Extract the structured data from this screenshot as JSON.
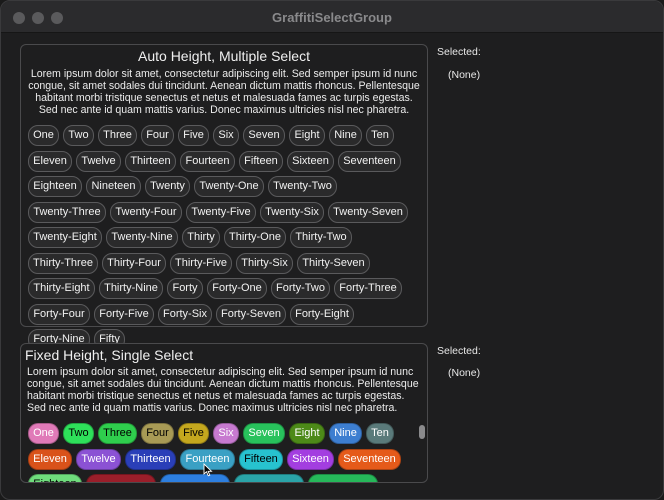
{
  "window": {
    "title": "GraffitiSelectGroup"
  },
  "description": "Lorem ipsum dolor sit amet, consectetur adipiscing elit. Sed semper ipsum id nunc congue, sit amet sodales dui tincidunt. Aenean dictum mattis rhoncus. Pellentesque habitant morbi tristique senectus et netus et malesuada fames ac turpis egestas. Sed nec ante id quam mattis varius. Donec maximus ultricies nisl nec pharetra.",
  "section1": {
    "title": "Auto Height, Multiple Select",
    "selected_label": "Selected:",
    "selected_value": "(None)",
    "chips": [
      "One",
      "Two",
      "Three",
      "Four",
      "Five",
      "Six",
      "Seven",
      "Eight",
      "Nine",
      "Ten",
      "Eleven",
      "Twelve",
      "Thirteen",
      "Fourteen",
      "Fifteen",
      "Sixteen",
      "Seventeen",
      "Eighteen",
      "Nineteen",
      "Twenty",
      "Twenty-One",
      "Twenty-Two",
      "Twenty-Three",
      "Twenty-Four",
      "Twenty-Five",
      "Twenty-Six",
      "Twenty-Seven",
      "Twenty-Eight",
      "Twenty-Nine",
      "Thirty",
      "Thirty-One",
      "Thirty-Two",
      "Thirty-Three",
      "Thirty-Four",
      "Thirty-Five",
      "Thirty-Six",
      "Thirty-Seven",
      "Thirty-Eight",
      "Thirty-Nine",
      "Forty",
      "Forty-One",
      "Forty-Two",
      "Forty-Three",
      "Forty-Four",
      "Forty-Five",
      "Forty-Six",
      "Forty-Seven",
      "Forty-Eight",
      "Forty-Nine",
      "Fifty"
    ]
  },
  "section2": {
    "title": "Fixed Height, Single Select",
    "selected_label": "Selected:",
    "selected_value": "(None)",
    "chips": [
      {
        "label": "One",
        "bg": "#e07ab8",
        "fg": "#ffffff"
      },
      {
        "label": "Two",
        "bg": "#2ee05a",
        "fg": "#000000"
      },
      {
        "label": "Three",
        "bg": "#2fce4d",
        "fg": "#000000"
      },
      {
        "label": "Four",
        "bg": "#a89a55",
        "fg": "#000000"
      },
      {
        "label": "Five",
        "bg": "#c4a71e",
        "fg": "#000000"
      },
      {
        "label": "Six",
        "bg": "#c77ad0",
        "fg": "#ffffff"
      },
      {
        "label": "Seven",
        "bg": "#28c25c",
        "fg": "#ffffff"
      },
      {
        "label": "Eight",
        "bg": "#4d8a18",
        "fg": "#ffffff"
      },
      {
        "label": "Nine",
        "bg": "#3d7ed0",
        "fg": "#ffffff"
      },
      {
        "label": "Ten",
        "bg": "#5a7a7a",
        "fg": "#ffffff"
      },
      {
        "label": "Eleven",
        "bg": "#d9521a",
        "fg": "#ffffff"
      },
      {
        "label": "Twelve",
        "bg": "#8b52d4",
        "fg": "#ffffff"
      },
      {
        "label": "Thirteen",
        "bg": "#2a3fb8",
        "fg": "#ffffff"
      },
      {
        "label": "Fourteen",
        "bg": "#3aa0c4",
        "fg": "#ffffff"
      },
      {
        "label": "Fifteen",
        "bg": "#27c2cf",
        "fg": "#000000"
      },
      {
        "label": "Sixteen",
        "bg": "#a33ee0",
        "fg": "#ffffff"
      },
      {
        "label": "Seventeen",
        "bg": "#e55a1a",
        "fg": "#ffffff"
      },
      {
        "label": "Eighteen",
        "bg": "#6fdc7c",
        "fg": "#000000"
      },
      {
        "label": "",
        "bg": "#9a1e2a",
        "fg": "#ffffff"
      },
      {
        "label": "",
        "bg": "#2d7fe0",
        "fg": "#ffffff"
      },
      {
        "label": "",
        "bg": "#2aa4a8",
        "fg": "#ffffff"
      },
      {
        "label": "",
        "bg": "#26b85a",
        "fg": "#ffffff"
      },
      {
        "label": "",
        "bg": "#b23cc8",
        "fg": "#ffffff"
      }
    ]
  }
}
